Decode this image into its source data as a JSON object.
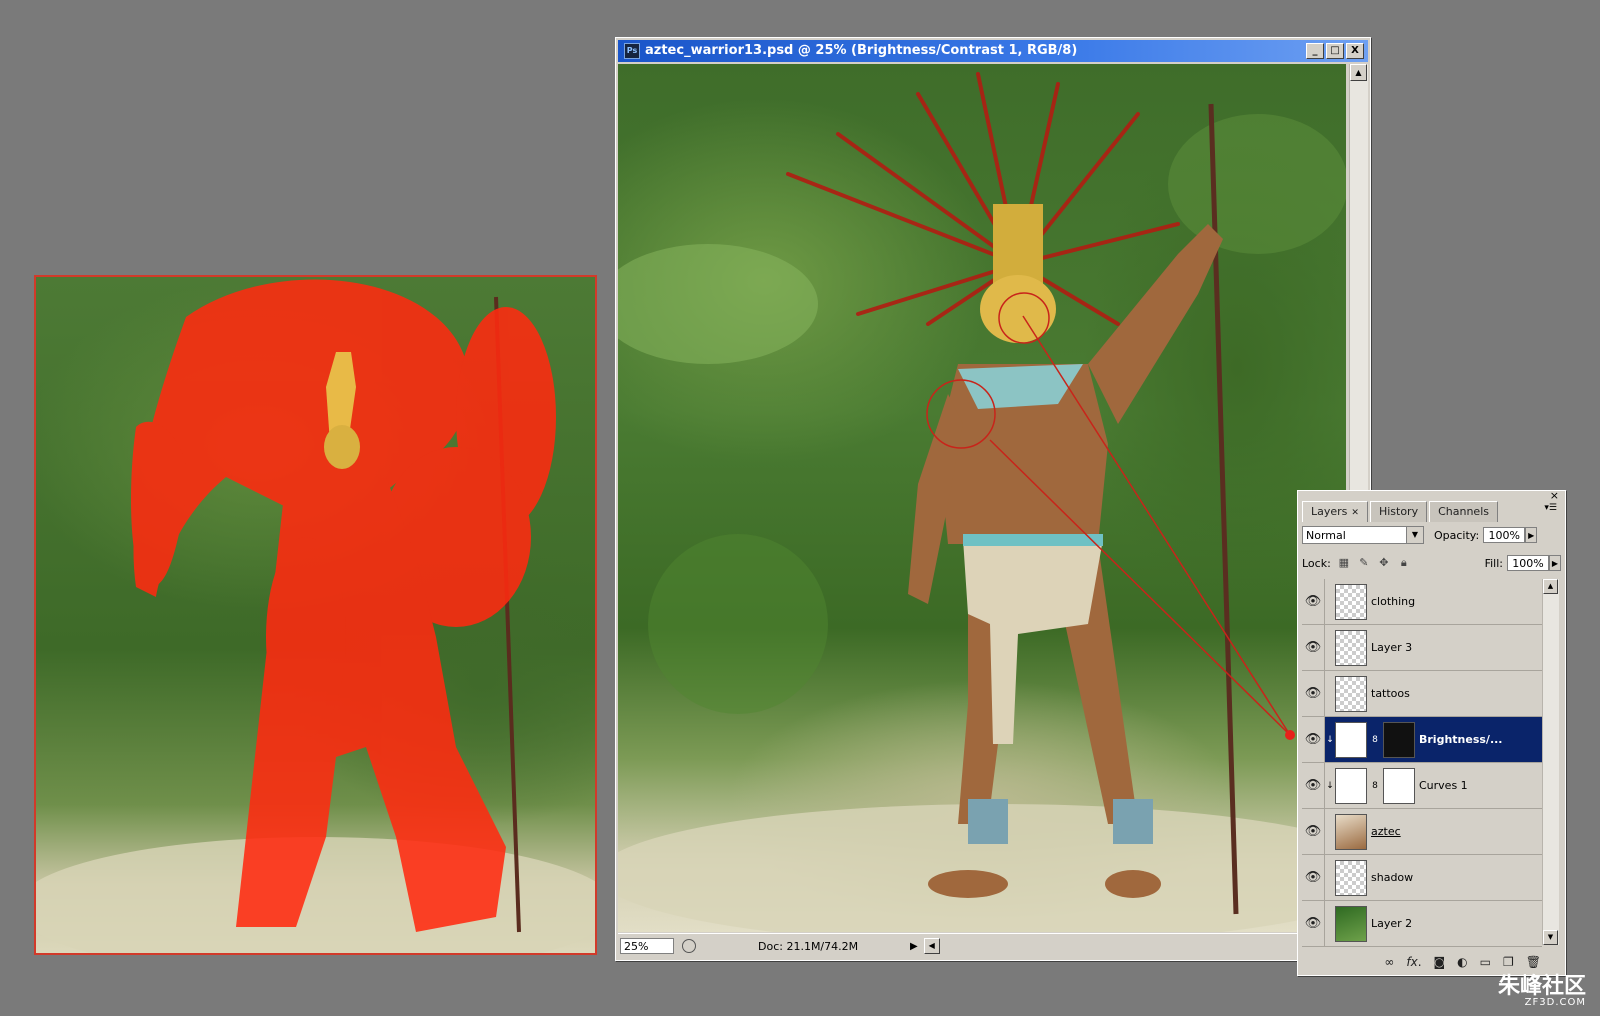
{
  "document": {
    "title": "aztec_warrior13.psd @ 25% (Brightness/Contrast 1, RGB/8)",
    "window_buttons": [
      "_",
      "□",
      "X"
    ],
    "zoom": "25%",
    "doc_size": "Doc: 21.1M/74.2M"
  },
  "layers_panel": {
    "tabs": [
      "Layers",
      "History",
      "Channels"
    ],
    "blend_mode": "Normal",
    "opacity_label": "Opacity:",
    "opacity_value": "100%",
    "lock_label": "Lock:",
    "fill_label": "Fill:",
    "fill_value": "100%",
    "layers": [
      {
        "name": "clothing",
        "thumb": "transparent"
      },
      {
        "name": "Layer 3",
        "thumb": "transparent"
      },
      {
        "name": "tattoos",
        "thumb": "transparent"
      },
      {
        "name": "Brightness/...",
        "thumb": "adjustment",
        "selected": true
      },
      {
        "name": "Curves 1",
        "thumb": "adjustment"
      },
      {
        "name": "aztec",
        "thumb": "warrior"
      },
      {
        "name": "shadow",
        "thumb": "transparent"
      },
      {
        "name": "Layer 2",
        "thumb": "photo"
      }
    ],
    "footer_icons": [
      "link-icon",
      "fx-icon",
      "mask-icon",
      "adjustment-icon",
      "group-icon",
      "new-layer-icon",
      "trash-icon"
    ]
  },
  "watermark": {
    "main": "朱峰社区",
    "sub": "ZF3D.COM"
  },
  "colors": {
    "mask_red": "#ff2a10",
    "selection_blue": "#0a246a",
    "titlebar_blue": "#1a55c9"
  }
}
